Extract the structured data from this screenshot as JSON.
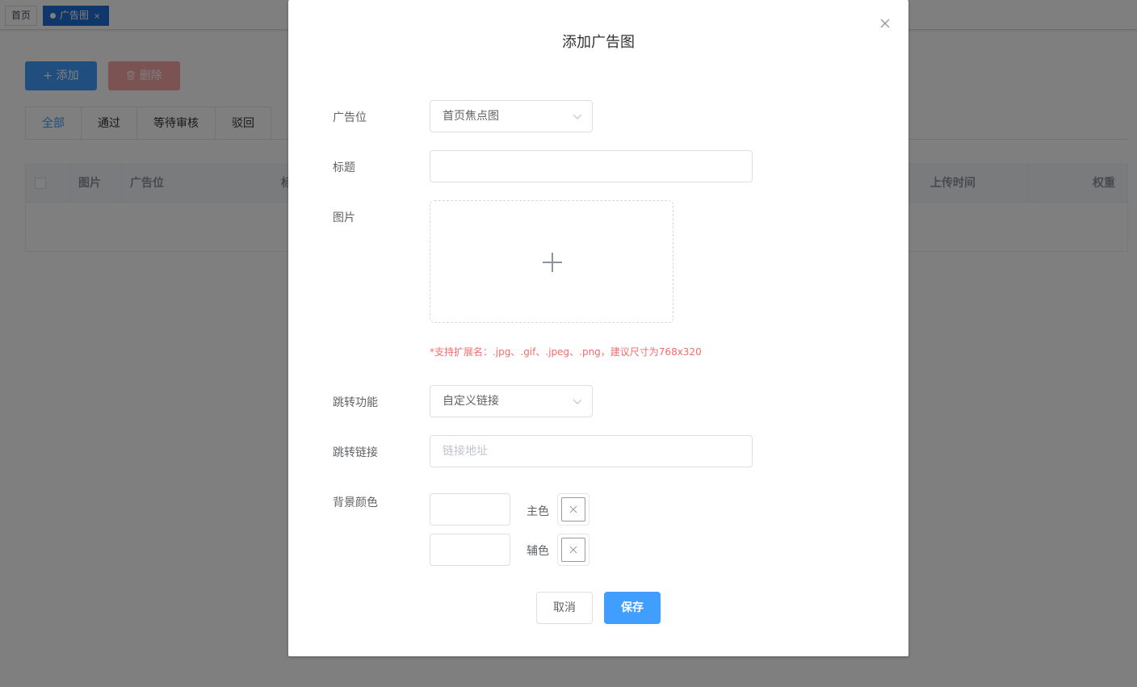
{
  "tags": {
    "home": "首页",
    "active": "广告图",
    "close": "×"
  },
  "toolbar": {
    "add_label": "添加",
    "delete_label": "删除"
  },
  "tabs": [
    "全部",
    "通过",
    "等待审核",
    "驳回"
  ],
  "table": {
    "columns": [
      "图片",
      "广告位",
      "标",
      "上传时间",
      "权重"
    ]
  },
  "dialog": {
    "title": "添加广告图",
    "fields": {
      "position_label": "广告位",
      "position_value": "首页焦点图",
      "title_label": "标题",
      "title_value": "",
      "image_label": "图片",
      "image_hint": "*支持扩展名：.jpg、.gif、.jpeg、.png，建议尺寸为768x320",
      "jump_label": "跳转功能",
      "jump_value": "自定义链接",
      "link_label": "跳转链接",
      "link_placeholder": "链接地址",
      "bg_color_label": "背景颜色",
      "primary_color_label": "主色",
      "secondary_color_label": "辅色"
    },
    "buttons": {
      "cancel": "取消",
      "save": "保存"
    }
  },
  "colors": {
    "primary": "#409eff",
    "danger": "#f56c6c",
    "active_tag": "#1f6fd6"
  }
}
